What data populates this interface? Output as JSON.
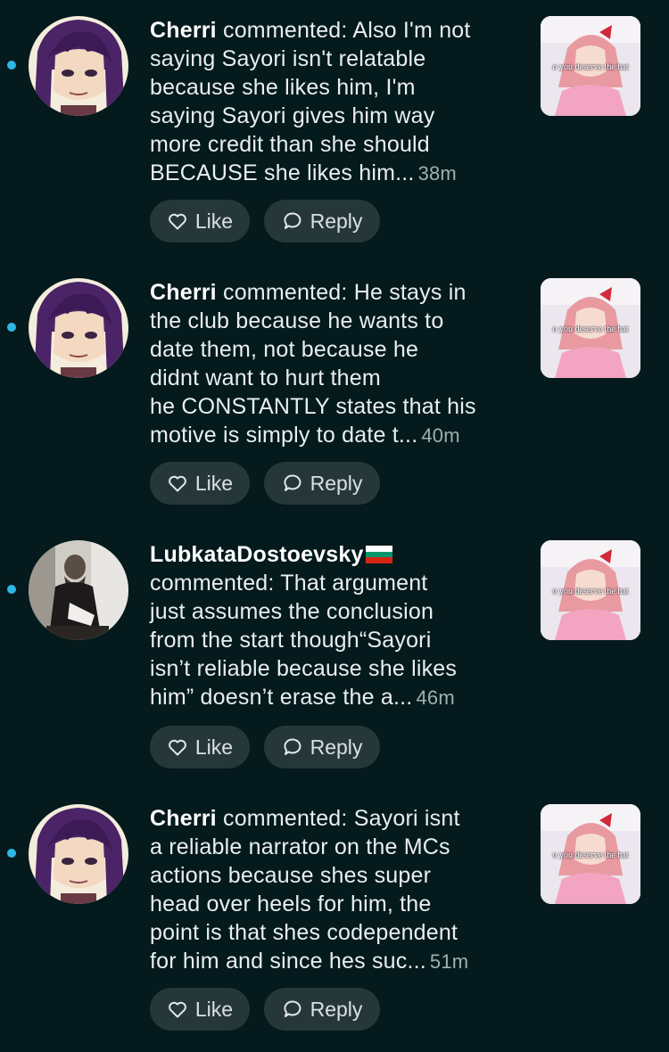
{
  "comments": [
    {
      "author": "Cherri",
      "action": " commented: ",
      "text_lines": [
        "Also I'm not",
        "saying Sayori isn't relatable",
        "because she likes him, I'm",
        "saying Sayori gives him way",
        "more credit than she should",
        "BECAUSE she likes him..."
      ],
      "time": "38m",
      "avatar_icon": "anime-avatar-purple-hair",
      "thumb_caption": "o you deserve the hat",
      "like_label": "Like",
      "reply_label": "Reply",
      "unread": true
    },
    {
      "author": "Cherri",
      "action": " commented: ",
      "text_lines": [
        "He stays in",
        "the club because he wants to",
        "date them, not because he",
        "didnt want to hurt them",
        "he CONSTANTLY states that his",
        "motive is simply to date t..."
      ],
      "time": "40m",
      "avatar_icon": "anime-avatar-purple-hair",
      "thumb_caption": "o you deserve the hat",
      "like_label": "Like",
      "reply_label": "Reply",
      "unread": true
    },
    {
      "author": "LubkataDostoevsky",
      "flag": "bulgaria-flag",
      "action": "commented: ",
      "text_lines": [
        "That argument",
        "just assumes the conclusion",
        "from the start though“Sayori",
        "isn’t reliable because she likes",
        "him” doesn’t erase the a..."
      ],
      "time": "46m",
      "avatar_icon": "vintage-portrait-photo",
      "thumb_caption": "o you deserve the hat",
      "like_label": "Like",
      "reply_label": "Reply",
      "unread": true
    },
    {
      "author": "Cherri",
      "action": " commented: ",
      "text_lines": [
        "Sayori isnt",
        "a reliable narrator on the MCs",
        "actions because shes super",
        "head over heels for him, the",
        "point is that shes codependent",
        "for him and since hes suc..."
      ],
      "time": "51m",
      "avatar_icon": "anime-avatar-purple-hair",
      "thumb_caption": "o you deserve the hat",
      "like_label": "Like",
      "reply_label": "Reply",
      "unread": true
    }
  ],
  "colors": {
    "background": "#041a1d",
    "unread_dot": "#2fb6e4",
    "button_bg": "#26373a"
  }
}
